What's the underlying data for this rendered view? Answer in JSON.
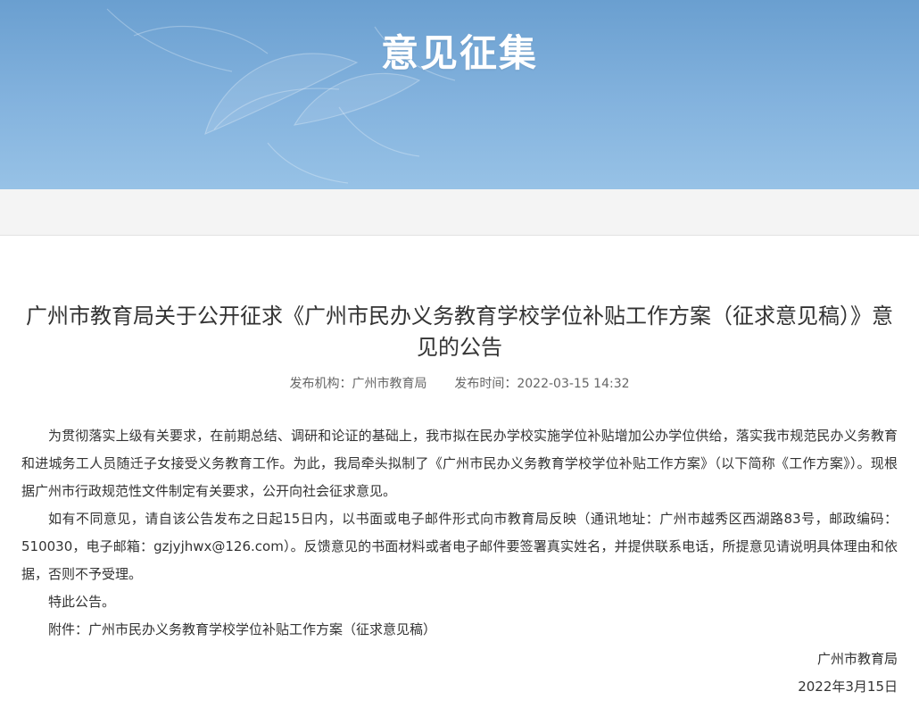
{
  "banner": {
    "title": "意见征集"
  },
  "article": {
    "title": "广州市教育局关于公开征求《广州市民办义务教育学校学位补贴工作方案（征求意见稿）》意见的公告",
    "meta": {
      "publisher_label": "发布机构：",
      "publisher": "广州市教育局",
      "time_label": "发布时间：",
      "time": "2022-03-15 14:32"
    },
    "paragraphs": [
      "为贯彻落实上级有关要求，在前期总结、调研和论证的基础上，我市拟在民办学校实施学位补贴增加公办学位供给，落实我市规范民办义务教育和进城务工人员随迁子女接受义务教育工作。为此，我局牵头拟制了《广州市民办义务教育学校学位补贴工作方案》（以下简称《工作方案》）。现根据广州市行政规范性文件制定有关要求，公开向社会征求意见。",
      "如有不同意见，请自该公告发布之日起15日内，以书面或电子邮件形式向市教育局反映（通讯地址：广州市越秀区西湖路83号，邮政编码：510030，电子邮箱：gzjyjhwx@126.com）。反馈意见的书面材料或者电子邮件要签署真实姓名，并提供联系电话，所提意见请说明具体理由和依据，否则不予受理。",
      "特此公告。",
      "附件：广州市民办义务教育学校学位补贴工作方案（征求意见稿）"
    ],
    "signature": {
      "org": "广州市教育局",
      "date": "2022年3月15日"
    }
  }
}
